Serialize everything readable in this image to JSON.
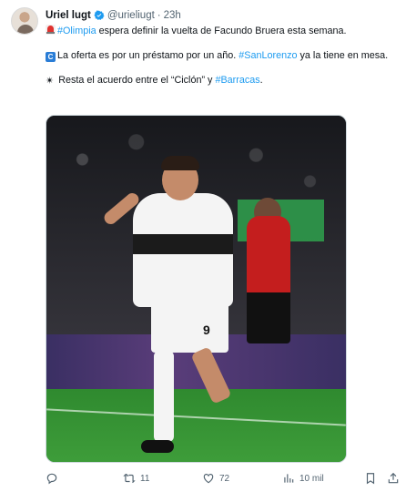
{
  "author": {
    "name": "Uriel lugt",
    "handle": "@urieliugt",
    "separator": "·",
    "time": "23h"
  },
  "tweet": {
    "p1_hashtag": "#Olimpia",
    "p1_text": " espera definir la vuelta de Facundo Bruera esta semana.",
    "p2_text_a": "La oferta es por un préstamo por un año. ",
    "p2_hashtag": "#SanLorenzo",
    "p2_text_b": " ya la tiene en mesa.",
    "p3_text": " Resta el acuerdo entre el “Ciclón” y ",
    "p3_hashtag": "#Barracas",
    "p3_end": "."
  },
  "media": {
    "shirt_number": "9"
  },
  "actions": {
    "retweets": "11",
    "likes": "72",
    "views": "10 mil"
  },
  "colors": {
    "link": "#1d9bf0",
    "verified": "#1d9bf0",
    "muted": "#536471"
  },
  "icons": [
    "siren-emoji-icon",
    "c-emoji-icon",
    "sparkle-emoji-icon",
    "verified-badge-icon",
    "reply-icon",
    "retweet-icon",
    "like-icon",
    "views-icon",
    "bookmark-icon",
    "share-icon"
  ]
}
